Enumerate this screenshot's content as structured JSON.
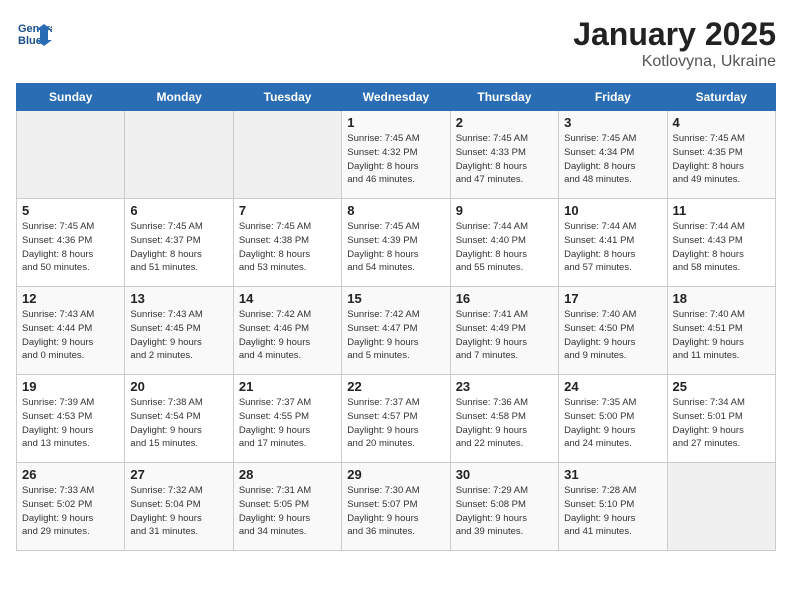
{
  "header": {
    "logo_line1": "General",
    "logo_line2": "Blue",
    "month": "January 2025",
    "location": "Kotlovyna, Ukraine"
  },
  "weekdays": [
    "Sunday",
    "Monday",
    "Tuesday",
    "Wednesday",
    "Thursday",
    "Friday",
    "Saturday"
  ],
  "weeks": [
    [
      {
        "day": "",
        "info": ""
      },
      {
        "day": "",
        "info": ""
      },
      {
        "day": "",
        "info": ""
      },
      {
        "day": "1",
        "info": "Sunrise: 7:45 AM\nSunset: 4:32 PM\nDaylight: 8 hours\nand 46 minutes."
      },
      {
        "day": "2",
        "info": "Sunrise: 7:45 AM\nSunset: 4:33 PM\nDaylight: 8 hours\nand 47 minutes."
      },
      {
        "day": "3",
        "info": "Sunrise: 7:45 AM\nSunset: 4:34 PM\nDaylight: 8 hours\nand 48 minutes."
      },
      {
        "day": "4",
        "info": "Sunrise: 7:45 AM\nSunset: 4:35 PM\nDaylight: 8 hours\nand 49 minutes."
      }
    ],
    [
      {
        "day": "5",
        "info": "Sunrise: 7:45 AM\nSunset: 4:36 PM\nDaylight: 8 hours\nand 50 minutes."
      },
      {
        "day": "6",
        "info": "Sunrise: 7:45 AM\nSunset: 4:37 PM\nDaylight: 8 hours\nand 51 minutes."
      },
      {
        "day": "7",
        "info": "Sunrise: 7:45 AM\nSunset: 4:38 PM\nDaylight: 8 hours\nand 53 minutes."
      },
      {
        "day": "8",
        "info": "Sunrise: 7:45 AM\nSunset: 4:39 PM\nDaylight: 8 hours\nand 54 minutes."
      },
      {
        "day": "9",
        "info": "Sunrise: 7:44 AM\nSunset: 4:40 PM\nDaylight: 8 hours\nand 55 minutes."
      },
      {
        "day": "10",
        "info": "Sunrise: 7:44 AM\nSunset: 4:41 PM\nDaylight: 8 hours\nand 57 minutes."
      },
      {
        "day": "11",
        "info": "Sunrise: 7:44 AM\nSunset: 4:43 PM\nDaylight: 8 hours\nand 58 minutes."
      }
    ],
    [
      {
        "day": "12",
        "info": "Sunrise: 7:43 AM\nSunset: 4:44 PM\nDaylight: 9 hours\nand 0 minutes."
      },
      {
        "day": "13",
        "info": "Sunrise: 7:43 AM\nSunset: 4:45 PM\nDaylight: 9 hours\nand 2 minutes."
      },
      {
        "day": "14",
        "info": "Sunrise: 7:42 AM\nSunset: 4:46 PM\nDaylight: 9 hours\nand 4 minutes."
      },
      {
        "day": "15",
        "info": "Sunrise: 7:42 AM\nSunset: 4:47 PM\nDaylight: 9 hours\nand 5 minutes."
      },
      {
        "day": "16",
        "info": "Sunrise: 7:41 AM\nSunset: 4:49 PM\nDaylight: 9 hours\nand 7 minutes."
      },
      {
        "day": "17",
        "info": "Sunrise: 7:40 AM\nSunset: 4:50 PM\nDaylight: 9 hours\nand 9 minutes."
      },
      {
        "day": "18",
        "info": "Sunrise: 7:40 AM\nSunset: 4:51 PM\nDaylight: 9 hours\nand 11 minutes."
      }
    ],
    [
      {
        "day": "19",
        "info": "Sunrise: 7:39 AM\nSunset: 4:53 PM\nDaylight: 9 hours\nand 13 minutes."
      },
      {
        "day": "20",
        "info": "Sunrise: 7:38 AM\nSunset: 4:54 PM\nDaylight: 9 hours\nand 15 minutes."
      },
      {
        "day": "21",
        "info": "Sunrise: 7:37 AM\nSunset: 4:55 PM\nDaylight: 9 hours\nand 17 minutes."
      },
      {
        "day": "22",
        "info": "Sunrise: 7:37 AM\nSunset: 4:57 PM\nDaylight: 9 hours\nand 20 minutes."
      },
      {
        "day": "23",
        "info": "Sunrise: 7:36 AM\nSunset: 4:58 PM\nDaylight: 9 hours\nand 22 minutes."
      },
      {
        "day": "24",
        "info": "Sunrise: 7:35 AM\nSunset: 5:00 PM\nDaylight: 9 hours\nand 24 minutes."
      },
      {
        "day": "25",
        "info": "Sunrise: 7:34 AM\nSunset: 5:01 PM\nDaylight: 9 hours\nand 27 minutes."
      }
    ],
    [
      {
        "day": "26",
        "info": "Sunrise: 7:33 AM\nSunset: 5:02 PM\nDaylight: 9 hours\nand 29 minutes."
      },
      {
        "day": "27",
        "info": "Sunrise: 7:32 AM\nSunset: 5:04 PM\nDaylight: 9 hours\nand 31 minutes."
      },
      {
        "day": "28",
        "info": "Sunrise: 7:31 AM\nSunset: 5:05 PM\nDaylight: 9 hours\nand 34 minutes."
      },
      {
        "day": "29",
        "info": "Sunrise: 7:30 AM\nSunset: 5:07 PM\nDaylight: 9 hours\nand 36 minutes."
      },
      {
        "day": "30",
        "info": "Sunrise: 7:29 AM\nSunset: 5:08 PM\nDaylight: 9 hours\nand 39 minutes."
      },
      {
        "day": "31",
        "info": "Sunrise: 7:28 AM\nSunset: 5:10 PM\nDaylight: 9 hours\nand 41 minutes."
      },
      {
        "day": "",
        "info": ""
      }
    ]
  ]
}
